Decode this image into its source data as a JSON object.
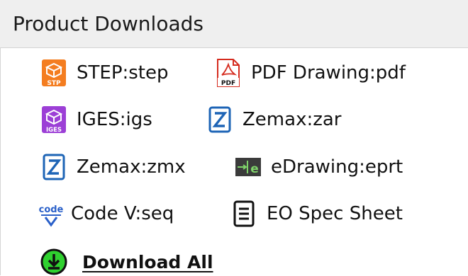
{
  "header": {
    "title": "Product Downloads"
  },
  "downloads": [
    {
      "label": "STEP:step",
      "icon": "step-file-icon",
      "icon_text": "STP"
    },
    {
      "label": "PDF Drawing:pdf",
      "icon": "pdf-file-icon",
      "icon_text": "PDF"
    },
    {
      "label": "IGES:igs",
      "icon": "iges-file-icon",
      "icon_text": "IGES"
    },
    {
      "label": "Zemax:zar",
      "icon": "zemax-icon"
    },
    {
      "label": "Zemax:zmx",
      "icon": "zemax-icon"
    },
    {
      "label": "eDrawing:eprt",
      "icon": "edrawing-icon"
    },
    {
      "label": "Code V:seq",
      "icon": "codev-icon",
      "icon_text": "code"
    },
    {
      "label": "EO Spec Sheet",
      "icon": "spec-sheet-icon"
    }
  ],
  "download_all": {
    "label": "Download All",
    "icon": "download-icon"
  },
  "colors": {
    "step": "#f47d20",
    "pdf": "#d52b1e",
    "iges": "#9c3fd6",
    "zemax": "#1d64b6",
    "codev": "#2a60c9",
    "download": "#2fd12f",
    "edrawing_green": "#2e9d46"
  }
}
